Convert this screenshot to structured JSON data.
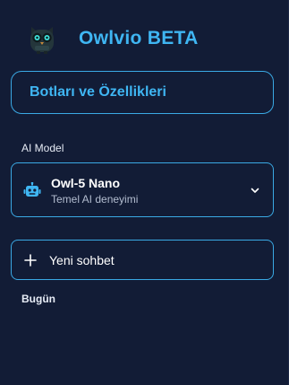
{
  "brand": {
    "name": "Owlvio BETA",
    "logo_icon": "owl-logo-icon"
  },
  "bots_button": {
    "label": "Botları ve Özellikleri"
  },
  "model_section": {
    "label": "AI Model",
    "selected": {
      "name": "Owl-5 Nano",
      "description": "Temel AI deneyimi",
      "icon": "robot-icon"
    }
  },
  "new_chat": {
    "label": "Yeni sohbet",
    "icon": "plus-icon"
  },
  "history": {
    "today_label": "Bugün"
  },
  "colors": {
    "background": "#121c36",
    "accent": "#3fb6f3",
    "border": "#3aa9e4"
  }
}
